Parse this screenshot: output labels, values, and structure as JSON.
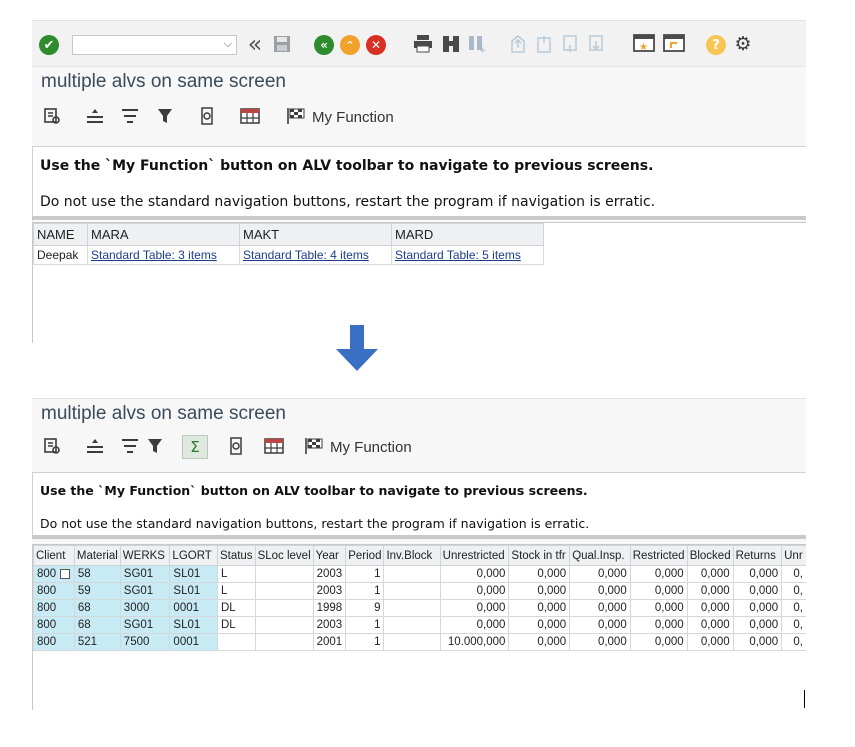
{
  "colors": {
    "accent_green": "#2e8b2e",
    "accent_orange": "#f0a22b",
    "accent_red": "#d93025",
    "key_cell_blue": "#c8eaf5",
    "link_blue": "#1b3e8a",
    "arrow_blue": "#3a6fc4"
  },
  "screen1": {
    "command_field": {
      "value": "",
      "placeholder": ""
    },
    "title": "multiple alvs on same screen",
    "toolbar": {
      "my_function_label": "My Function"
    },
    "message": {
      "bold": "Use the `My Function` button on ALV toolbar to navigate to previous screens.",
      "normal": "Do not use the standard navigation buttons, restart the program if navigation is erratic."
    },
    "grid": {
      "headers": [
        "NAME",
        "MARA",
        "MAKT",
        "MARD"
      ],
      "rows": [
        [
          "Deepak",
          "Standard Table: 3 items",
          "Standard Table: 4 items",
          "Standard Table: 5 items"
        ]
      ]
    }
  },
  "screen2": {
    "title": "multiple alvs on same screen",
    "toolbar": {
      "sum_label": "Σ",
      "my_function_label": "My Function"
    },
    "message": {
      "bold": "Use the `My Function` button on ALV toolbar to navigate to previous screens.",
      "normal": "Do not use the standard navigation buttons, restart the program if navigation is erratic."
    },
    "grid": {
      "headers": [
        "Client",
        "Material",
        "WERKS",
        "LGORT",
        "Status",
        "SLoc level",
        "Year",
        "Period",
        "Inv.Block",
        "Unrestricted",
        "Stock in tfr",
        "Qual.Insp.",
        "Restricted",
        "Blocked",
        "Returns",
        "Unr"
      ],
      "rows": [
        [
          "800",
          "58",
          "SG01",
          "SL01",
          "L",
          "",
          "2003",
          "1",
          "",
          "0,000",
          "0,000",
          "0,000",
          "0,000",
          "0,000",
          "0,000",
          "0,"
        ],
        [
          "800",
          "59",
          "SG01",
          "SL01",
          "L",
          "",
          "2003",
          "1",
          "",
          "0,000",
          "0,000",
          "0,000",
          "0,000",
          "0,000",
          "0,000",
          "0,"
        ],
        [
          "800",
          "68",
          "3000",
          "0001",
          "DL",
          "",
          "1998",
          "9",
          "",
          "0,000",
          "0,000",
          "0,000",
          "0,000",
          "0,000",
          "0,000",
          "0,"
        ],
        [
          "800",
          "68",
          "SG01",
          "SL01",
          "DL",
          "",
          "2003",
          "1",
          "",
          "0,000",
          "0,000",
          "0,000",
          "0,000",
          "0,000",
          "0,000",
          "0,"
        ],
        [
          "800",
          "521",
          "7500",
          "0001",
          "",
          "",
          "2001",
          "1",
          "",
          "10.000,000",
          "0,000",
          "0,000",
          "0,000",
          "0,000",
          "0,000",
          "0,"
        ]
      ]
    }
  }
}
